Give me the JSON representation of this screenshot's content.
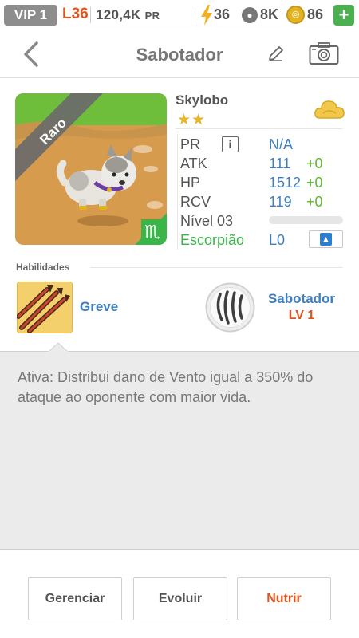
{
  "status_bar": {
    "vip": "VIP 1",
    "level": "L36",
    "power_value": "120,4K",
    "power_unit": "PR",
    "energy": "36",
    "paws": "8K",
    "coins": "86",
    "plus": "+"
  },
  "header": {
    "title": "Sabotador",
    "back_icon": "chevron-left-icon",
    "edit_icon": "pencil-icon",
    "camera_icon": "camera-icon"
  },
  "monster": {
    "rarity": "Raro",
    "name": "Skylobo",
    "stars": "★★",
    "star_count": 2,
    "element_icon": "cloud-icon",
    "zodiac_icon": "scorpio-icon",
    "level_progress": 0
  },
  "stats": {
    "pr_label": "PR",
    "info_icon": "i",
    "pr_value": "N/A",
    "atk_label": "ATK",
    "atk_value": "111",
    "atk_bonus": "+0",
    "hp_label": "HP",
    "hp_value": "1512",
    "hp_bonus": "+0",
    "rcv_label": "RCV",
    "rcv_value": "119",
    "rcv_bonus": "+0",
    "level_label": "Nível 03",
    "zodiac_label": "Escorpião",
    "zodiac_level": "L0",
    "upgrade_icon": "arrow-up-icon"
  },
  "abilities": {
    "section_label": "Habilidades",
    "skill_name": "Greve",
    "skill_icon": "arrows-icon",
    "leader_icon": "claw-icon",
    "leader_name": "Sabotador",
    "leader_level": "LV 1"
  },
  "description": "Ativa: Distribui dano de Vento igual a 350% do ataque ao oponente com maior vida.",
  "buttons": {
    "manage": "Gerenciar",
    "evolve": "Evoluir",
    "feed": "Nutrir"
  },
  "colors": {
    "accent_blue": "#3d7fc0",
    "accent_orange": "#e1541b",
    "accent_green": "#5cb82c",
    "star_gold": "#e8b325"
  }
}
